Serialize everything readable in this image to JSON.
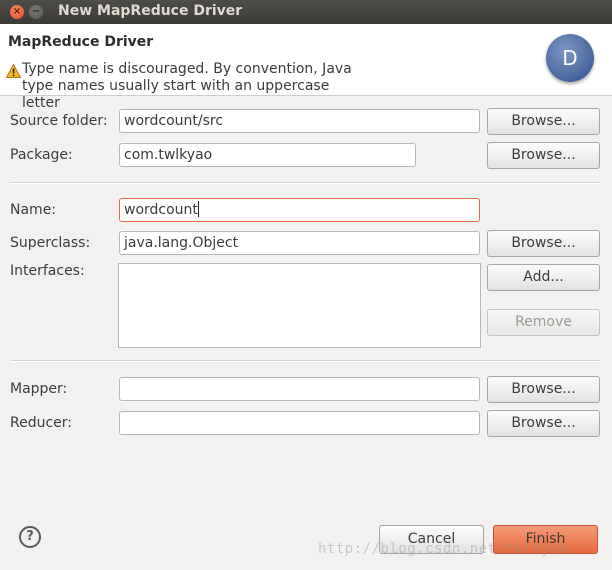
{
  "window": {
    "title": "New MapReduce Driver"
  },
  "banner": {
    "title": "MapReduce Driver",
    "message_line1": "Type name is discouraged. By convention, Java",
    "message_line2": "type names usually start with an uppercase letter",
    "logo_letter": "D"
  },
  "form": {
    "source_folder": {
      "label": "Source folder:",
      "value": "wordcount/src",
      "button": "Browse..."
    },
    "package": {
      "label": "Package:",
      "value": "com.twlkyao",
      "button": "Browse..."
    },
    "name": {
      "label": "Name:",
      "value": "wordcount"
    },
    "superclass": {
      "label": "Superclass:",
      "value": "java.lang.Object",
      "button": "Browse..."
    },
    "interfaces": {
      "label": "Interfaces:",
      "add_button": "Add...",
      "remove_button": "Remove"
    },
    "mapper": {
      "label": "Mapper:",
      "value": "",
      "button": "Browse..."
    },
    "reducer": {
      "label": "Reducer:",
      "value": "",
      "button": "Browse..."
    }
  },
  "footer": {
    "help_glyph": "?",
    "cancel": "Cancel",
    "finish": "Finish",
    "watermark": "http://blog.csdn.net/twlkyao"
  },
  "colors": {
    "accent": "#e7683f",
    "titlebar": "#3c3b37",
    "focus_border": "#e06b48"
  }
}
